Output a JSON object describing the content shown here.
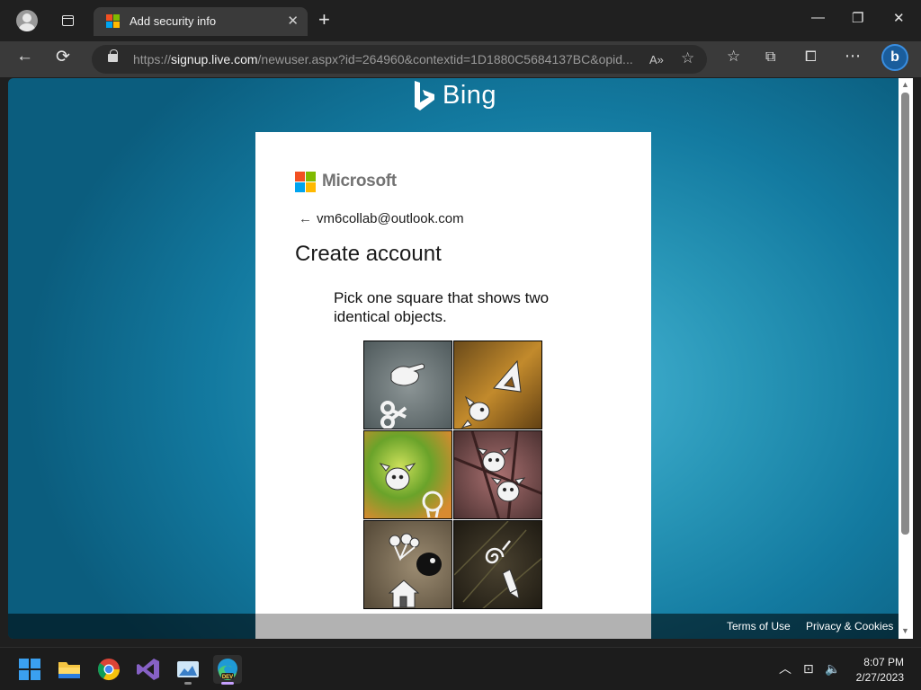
{
  "browser": {
    "tab_title": "Add security info",
    "tab_close_glyph": "✕",
    "new_tab_glyph": "+",
    "url_prefix": "https://",
    "url_host": "signup.live.com",
    "url_rest": "/newuser.aspx?id=264960&contextid=1D1880C5684137BC&opid...",
    "window_controls": {
      "minimize": "—",
      "restore": "❐",
      "close": "✕"
    },
    "icons": [
      "profile-icon",
      "tab-actions-icon",
      "back-icon",
      "refresh-icon",
      "lock-icon",
      "read-aloud-icon",
      "add-favorite-icon",
      "favorites-icon",
      "collections-icon",
      "extensions-icon",
      "more-icon",
      "bing-chat-icon"
    ],
    "glyphs": {
      "back": "←",
      "refresh": "⟳",
      "read_aloud": "A»",
      "add_favorite": "☆",
      "favorites": "☆",
      "collections": "⧉",
      "extensions": "⧠",
      "more": "⋯",
      "bing": "b"
    }
  },
  "page": {
    "brand": "Bing",
    "card": {
      "company": "Microsoft",
      "back_arrow": "←",
      "account_email": "vm6collab@outlook.com",
      "heading": "Create account",
      "prompt": "Pick one square that shows two identical objects.",
      "puzzle_tiles": [
        {
          "id": 1,
          "objects": [
            "pointing-hand-icon",
            "scissors-icon"
          ],
          "background": "grey stone"
        },
        {
          "id": 2,
          "objects": [
            "ruler-triangle-icon",
            "dog-icon"
          ],
          "background": "autumn leaf"
        },
        {
          "id": 3,
          "objects": [
            "dog-icon",
            "map-pin-icon"
          ],
          "background": "green foliage"
        },
        {
          "id": 4,
          "objects": [
            "dog-icon",
            "dog-icon"
          ],
          "background": "pink blossoms"
        },
        {
          "id": 5,
          "objects": [
            "balloons-icon",
            "house-icon"
          ],
          "background": "squirrel"
        },
        {
          "id": 6,
          "objects": [
            "spiral-icon",
            "crayon-icon"
          ],
          "background": "dark pine"
        }
      ]
    },
    "footer": {
      "terms": "Terms of Use",
      "privacy": "Privacy & Cookies"
    }
  },
  "taskbar": {
    "apps": [
      "start-icon",
      "file-explorer-icon",
      "chrome-icon",
      "visual-studio-icon",
      "photos-icon",
      "edge-dev-icon"
    ],
    "tray": {
      "chevron": "︿",
      "network": "⊡",
      "volume": "🔈"
    },
    "time": "8:07 PM",
    "date": "2/27/2023"
  },
  "colors": {
    "ms_red": "#f25022",
    "ms_green": "#7fba00",
    "ms_blue": "#00a4ef",
    "ms_yellow": "#ffb900",
    "page_bg": "#1a85ab",
    "chrome_dark": "#202020",
    "chrome_toolbar": "#3a3a3a"
  }
}
